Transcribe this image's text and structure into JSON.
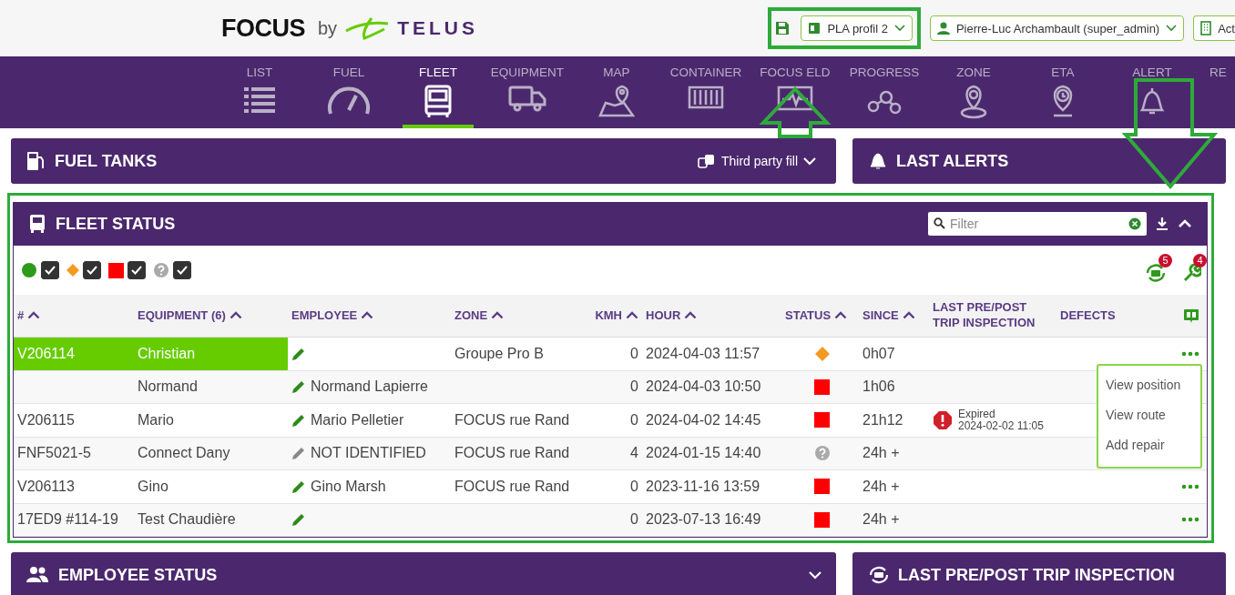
{
  "header": {
    "logo": {
      "brand": "FOCUS",
      "connector": "by",
      "partner": "TELUS"
    },
    "profile": "PLA profil 2",
    "user": "Pierre-Luc Archambault (super_admin)",
    "account": "Act"
  },
  "nav": [
    {
      "label": "LIST",
      "kind": "list",
      "selected": false
    },
    {
      "label": "FUEL",
      "kind": "gauge",
      "selected": false
    },
    {
      "label": "FLEET",
      "kind": "bus",
      "selected": true
    },
    {
      "label": "EQUIPMENT",
      "kind": "truck",
      "selected": false
    },
    {
      "label": "MAP",
      "kind": "map",
      "selected": false
    },
    {
      "label": "CONTAINER",
      "kind": "container",
      "selected": false
    },
    {
      "label": "FOCUS ELD",
      "kind": "monitor",
      "selected": false
    },
    {
      "label": "PROGRESS",
      "kind": "nodes",
      "selected": false
    },
    {
      "label": "ZONE",
      "kind": "pin",
      "selected": false
    },
    {
      "label": "ETA",
      "kind": "clockpin",
      "selected": false
    },
    {
      "label": "ALERT",
      "kind": "bell",
      "selected": false
    },
    {
      "label": "RE",
      "kind": "cut",
      "selected": false
    }
  ],
  "fuel_tanks": {
    "title": "FUEL TANKS",
    "filter": "Third party fill"
  },
  "last_alerts": {
    "title": "LAST ALERTS"
  },
  "fleet_status": {
    "title": "FLEET STATUS",
    "filter_placeholder": "Filter",
    "legend": [
      {
        "kind": "dot",
        "color": "#2e9a1c",
        "checked": true
      },
      {
        "kind": "diamond",
        "color": "#f39a22",
        "checked": true
      },
      {
        "kind": "square",
        "color": "#ff0000",
        "checked": true
      },
      {
        "kind": "unknown",
        "color": "#aaaaaa",
        "checked": true
      }
    ],
    "badges": [
      {
        "kind": "inspection",
        "count": "5"
      },
      {
        "kind": "repair",
        "count": "4"
      }
    ],
    "columns": [
      {
        "label": "#",
        "sortable": true
      },
      {
        "label": "EQUIPMENT (6)",
        "sortable": true
      },
      {
        "label": "EMPLOYEE",
        "sortable": true
      },
      {
        "label": "ZONE",
        "sortable": true
      },
      {
        "label": "KMH",
        "sortable": true
      },
      {
        "label": "HOUR",
        "sortable": true
      },
      {
        "label": "STATUS",
        "sortable": true
      },
      {
        "label": "SINCE",
        "sortable": true
      },
      {
        "label": "LAST PRE/POST TRIP INSPECTION",
        "sortable": false
      },
      {
        "label": "DEFECTS",
        "sortable": false
      }
    ],
    "rows": [
      {
        "number": "V206114",
        "equipment": "Christian",
        "employee": "",
        "identified": true,
        "zone": "Groupe Pro B",
        "kmh": "0",
        "hour": "2024-04-03 11:57",
        "status": {
          "kind": "diamond"
        },
        "since": "0h07",
        "selected": true,
        "actions": true,
        "menu": [
          "View position",
          "View route",
          "Add repair"
        ]
      },
      {
        "number": "",
        "equipment": "Normand",
        "employee": "Normand Lapierre",
        "identified": true,
        "zone": "",
        "kmh": "0",
        "hour": "2024-04-03 10:50",
        "status": {
          "kind": "square"
        },
        "since": "1h06",
        "selected": false,
        "actions": false
      },
      {
        "number": "V206115",
        "equipment": "Mario",
        "employee": "Mario Pelletier",
        "identified": true,
        "zone": "FOCUS rue Rand",
        "kmh": "0",
        "hour": "2024-04-02 14:45",
        "status": {
          "kind": "square"
        },
        "since": "21h12",
        "inspection": {
          "label": "Expired",
          "date": "2024-02-02 11:05"
        },
        "selected": false,
        "actions": false
      },
      {
        "number": "FNF5021-5",
        "equipment": "Connect Dany",
        "employee": "NOT IDENTIFIED",
        "identified": false,
        "zone": "FOCUS rue Rand",
        "kmh": "4",
        "hour": "2024-01-15 14:40",
        "status": {
          "kind": "unknown"
        },
        "since": "24h +",
        "selected": false,
        "actions": false
      },
      {
        "number": "V206113",
        "equipment": "Gino",
        "employee": "Gino Marsh",
        "identified": true,
        "zone": "FOCUS rue Rand",
        "kmh": "0",
        "hour": "2023-11-16 13:59",
        "status": {
          "kind": "square"
        },
        "since": "24h +",
        "selected": false,
        "actions": true
      },
      {
        "number": "17ED9 #114-19",
        "equipment": "Test Chaudière",
        "employee": "",
        "identified": true,
        "zone": "",
        "kmh": "0",
        "hour": "2023-07-13 16:49",
        "status": {
          "kind": "square"
        },
        "since": "24h +",
        "selected": false,
        "actions": true
      }
    ]
  },
  "employee_status": {
    "title": "EMPLOYEE STATUS"
  },
  "last_inspection": {
    "title": "LAST PRE/POST TRIP INSPECTION"
  }
}
